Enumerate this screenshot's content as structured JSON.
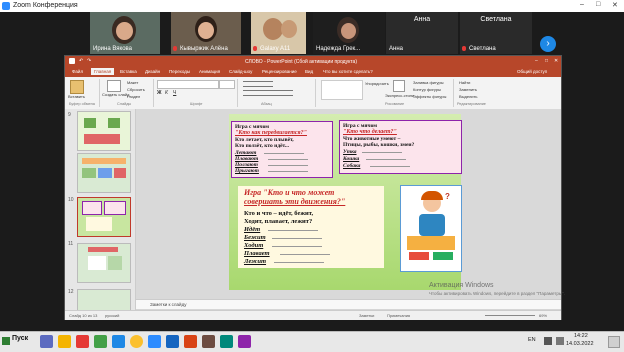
{
  "zoom": {
    "title": "Zoom Конференция",
    "participants": [
      {
        "name": "Ирина Вякова"
      },
      {
        "name": "Кывыржик Алёна"
      },
      {
        "name": "Galaxy A11"
      },
      {
        "name": "Надежда Грек..."
      },
      {
        "name": "Анна"
      },
      {
        "name": "Светлана"
      }
    ],
    "top_names": [
      "Анна",
      "Светлана"
    ]
  },
  "ppt": {
    "title": "СЛОВО - PowerPoint (Сбой активации продукта)",
    "tabs": [
      "Файл",
      "Главная",
      "Вставка",
      "Дизайн",
      "Переходы",
      "Анимация",
      "Слайд-шоу",
      "Рецензирование",
      "Вид",
      "Что вы хотите сделать?"
    ],
    "share": "Общий доступ",
    "ribbon": {
      "paste": "Вставить",
      "create_slide": "Создать слайд",
      "layout": "Макет",
      "reset": "Сбросить",
      "section": "Раздел",
      "groups": [
        "Буфер обмена",
        "Слайды",
        "Шрифт",
        "Абзац",
        "Рисование",
        "Редактирование"
      ],
      "arrange": "Упорядочить",
      "express": "Экспресс-стили",
      "fill": "Заливка фигуры",
      "outline": "Контур фигуры",
      "effects": "Эффекты фигуры",
      "find": "Найти",
      "replace": "Заменить",
      "select": "Выделить"
    },
    "thumb_numbers": [
      "9",
      "10",
      "11",
      "12"
    ],
    "notes": "Заметки к слайду",
    "status": {
      "slide": "Слайд 10 из 13",
      "lang": "русский",
      "notes": "Заметки",
      "comments": "Примечания",
      "zoom": "69%"
    }
  },
  "slide": {
    "box1": {
      "l1": "Игра с мячом",
      "l2": "\"Кто как передвигается?\"",
      "l3": "Кто летает, кто плывёт,",
      "l4": "Кто ползёт, кто идёт...",
      "w1": "Летают",
      "w2": "Плавают",
      "w3": "Ползают",
      "w4": "Прыгают"
    },
    "box2": {
      "l1": "Игра с мячом",
      "l2": "\"Кто что делает?\"",
      "l3": "Что животные умеют –",
      "l4": "Птицы, рыбы, кошки, змеи?",
      "w1": "Утка",
      "w2": "Кошка",
      "w3": "Собака"
    },
    "box3": {
      "title1": "Игра \"Кто и что может",
      "title2": "совершать эти движения?\"",
      "l1": "Кто и что – идёт, бежит,",
      "l2": "Ходит, плавает, лежит?",
      "w1": "Идёт",
      "w2": "Бежит",
      "w3": "Ходит",
      "w4": "Плавает",
      "w5": "Лежит"
    }
  },
  "watermark": {
    "l1": "Активация Windows",
    "l2": "Чтобы активировать Windows, перейдите в раздел \"Параметры\"."
  },
  "taskbar": {
    "start": "Пуск",
    "lang": "EN",
    "time": "14:22",
    "date": "14.03.2022"
  },
  "colors": {
    "ppt_accent": "#b7472a",
    "zoom_blue": "#2d8cff",
    "slide_green": "#a8d86e",
    "box_border": "#8e24aa"
  }
}
